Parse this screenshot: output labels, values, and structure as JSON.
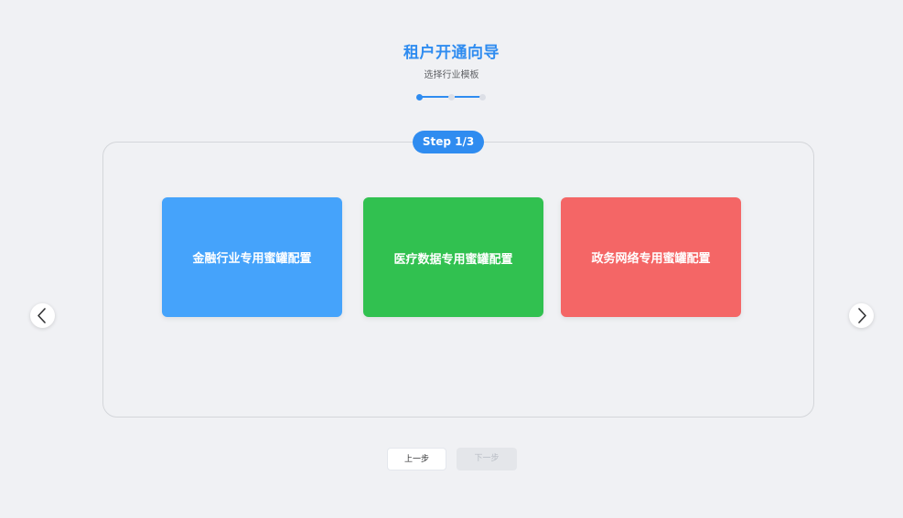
{
  "header": {
    "title": "租户开通向导",
    "subtitle": "选择行业模板"
  },
  "progress": {
    "current_step": 1,
    "total_steps": 3
  },
  "step_badge": "Step 1/3",
  "cards": [
    {
      "label": "金融行业专用蜜罐配置",
      "color": "#45a3fb"
    },
    {
      "label": "医疗数据专用蜜罐配置",
      "color": "#31c150"
    },
    {
      "label": "政务网络专用蜜罐配置",
      "color": "#f46666"
    }
  ],
  "navigation": {
    "prev_arrow_icon": "chevron-left-icon",
    "next_arrow_icon": "chevron-right-icon"
  },
  "buttons": {
    "prev_label": "上一步",
    "next_label": "下一步"
  },
  "colors": {
    "accent": "#2f8cf0",
    "background": "#f0f1f4"
  }
}
